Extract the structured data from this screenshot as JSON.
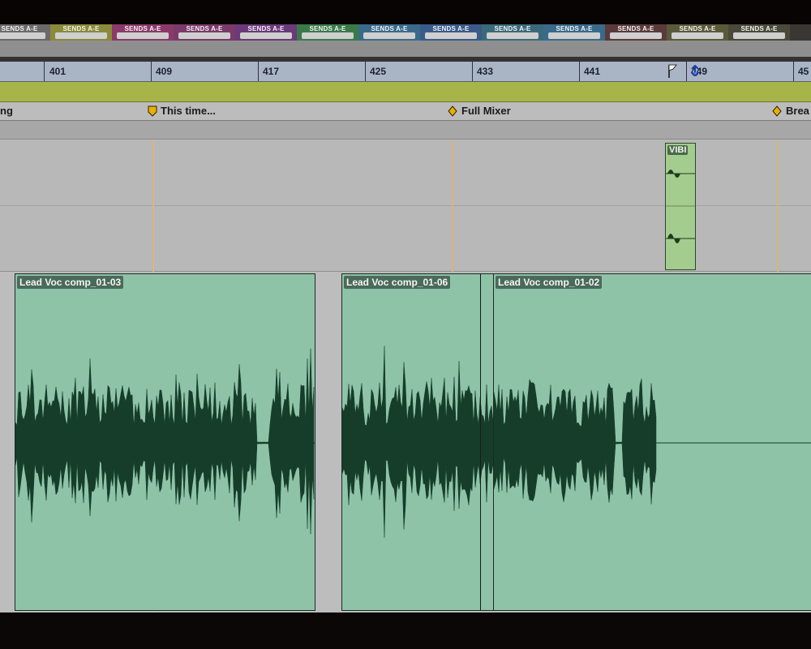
{
  "sends": {
    "label": "SENDS A-E",
    "slots": [
      {
        "color": "#6a6a6a",
        "bus": ""
      },
      {
        "color": "#8a8a3a",
        "bus": ""
      },
      {
        "color": "#8a3a6a",
        "bus": ""
      },
      {
        "color": "#7a3a6a",
        "bus": ""
      },
      {
        "color": "#6a3a7a",
        "bus": ""
      },
      {
        "color": "#3a7a4a",
        "bus": ""
      },
      {
        "color": "#3a6a8a",
        "bus": ""
      },
      {
        "color": "#3a5a8a",
        "bus": ""
      },
      {
        "color": "#3a6a7a",
        "bus": ""
      },
      {
        "color": "#3a6a8a",
        "bus": ""
      },
      {
        "color": "#5a3a3a",
        "bus": ""
      },
      {
        "color": "#5a5a3a",
        "bus": ""
      },
      {
        "color": "#4a4a3a",
        "bus": ""
      }
    ]
  },
  "ruler": {
    "bars": [
      "401",
      "409",
      "417",
      "425",
      "433",
      "441",
      "449",
      "45"
    ]
  },
  "markers": [
    {
      "label": "ng",
      "type": "none"
    },
    {
      "label": "This time...",
      "type": "shield"
    },
    {
      "label": "Full Mixer",
      "type": "diamond"
    },
    {
      "label": "Brea",
      "type": "diamond"
    }
  ],
  "clips": [
    {
      "name": "Lead Voc comp_01-03"
    },
    {
      "name": "Lead Voc comp_01-06"
    },
    {
      "name": "Lead Voc comp_01-02"
    }
  ],
  "vibi_clip": {
    "name": "VIBI"
  },
  "colors": {
    "clip_fill": "#8ec3a8",
    "waveform": "#163d2a",
    "ruler": "#a9b4c5",
    "marker_track": "#a6b44a",
    "marker_icon": "#e8b000"
  }
}
